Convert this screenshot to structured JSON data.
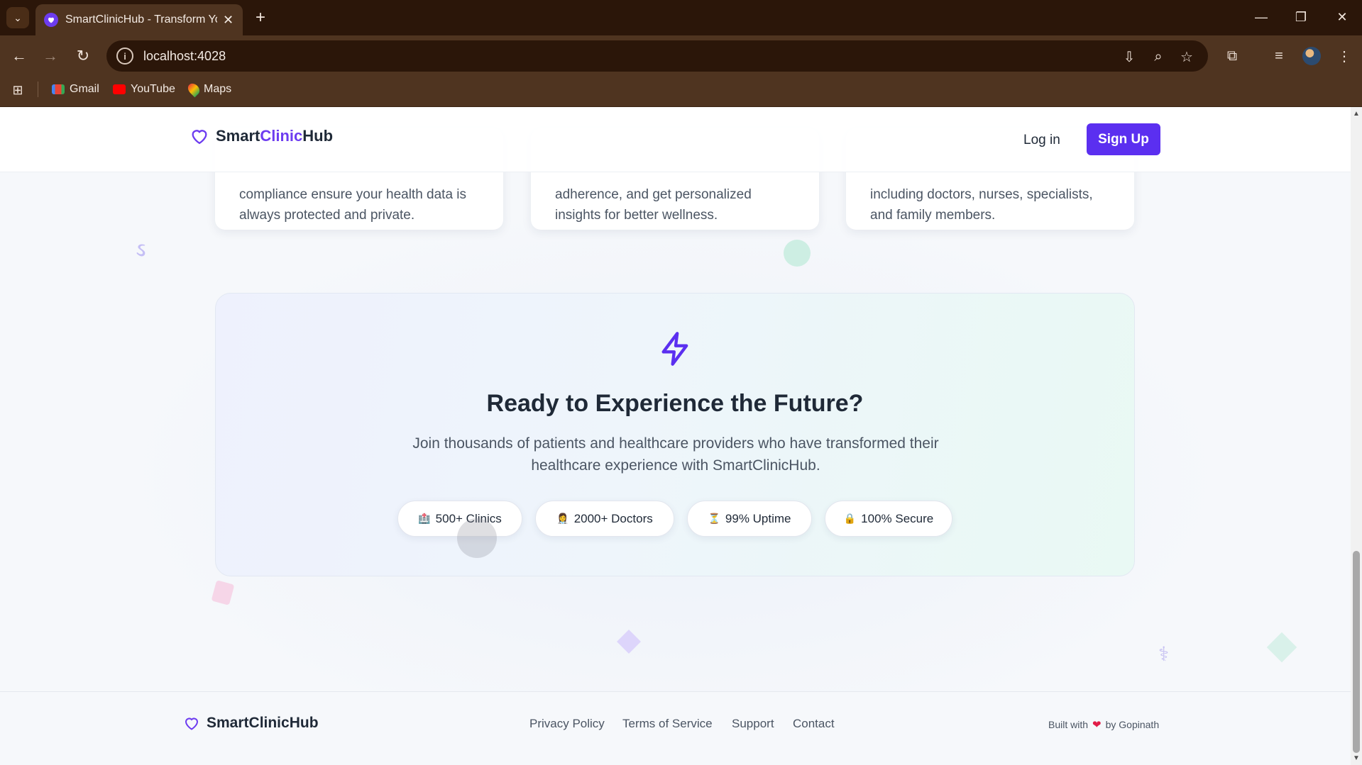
{
  "browser": {
    "tab_title": "SmartClinicHub - Transform Your",
    "url": "localhost:4028",
    "bookmarks": [
      {
        "label": "Gmail",
        "icon": "gmail-icon"
      },
      {
        "label": "YouTube",
        "icon": "youtube-icon"
      },
      {
        "label": "Maps",
        "icon": "maps-icon"
      }
    ]
  },
  "header": {
    "brand_a": "Smart",
    "brand_b": "Clinic",
    "brand_c": "Hub",
    "login": "Log in",
    "signup": "Sign Up"
  },
  "feature_cards": [
    {
      "text": "compliance ensure your health data is always protected and private."
    },
    {
      "text": "adherence, and get personalized insights for better wellness."
    },
    {
      "text": "including doctors, nurses, specialists, and family members."
    }
  ],
  "cta": {
    "icon": "lightning-icon",
    "title": "Ready to Experience the Future?",
    "subtitle": "Join thousands of patients and healthcare providers who have transformed their healthcare experience with SmartClinicHub.",
    "stats": [
      {
        "emoji": "🏥",
        "label": "500+ Clinics"
      },
      {
        "emoji": "👩‍⚕️",
        "label": "2000+ Doctors"
      },
      {
        "emoji": "⏳",
        "label": "99% Uptime"
      },
      {
        "emoji": "🔒",
        "label": "100% Secure"
      }
    ]
  },
  "footer": {
    "brand": "SmartClinicHub",
    "links": [
      "Privacy Policy",
      "Terms of Service",
      "Support",
      "Contact"
    ],
    "built_with": "Built with",
    "built_by": "by Gopinath"
  },
  "colors": {
    "brand_purple": "#5b2ff0",
    "chrome_dark": "#2b1609",
    "chrome_mid": "#4f3420"
  }
}
